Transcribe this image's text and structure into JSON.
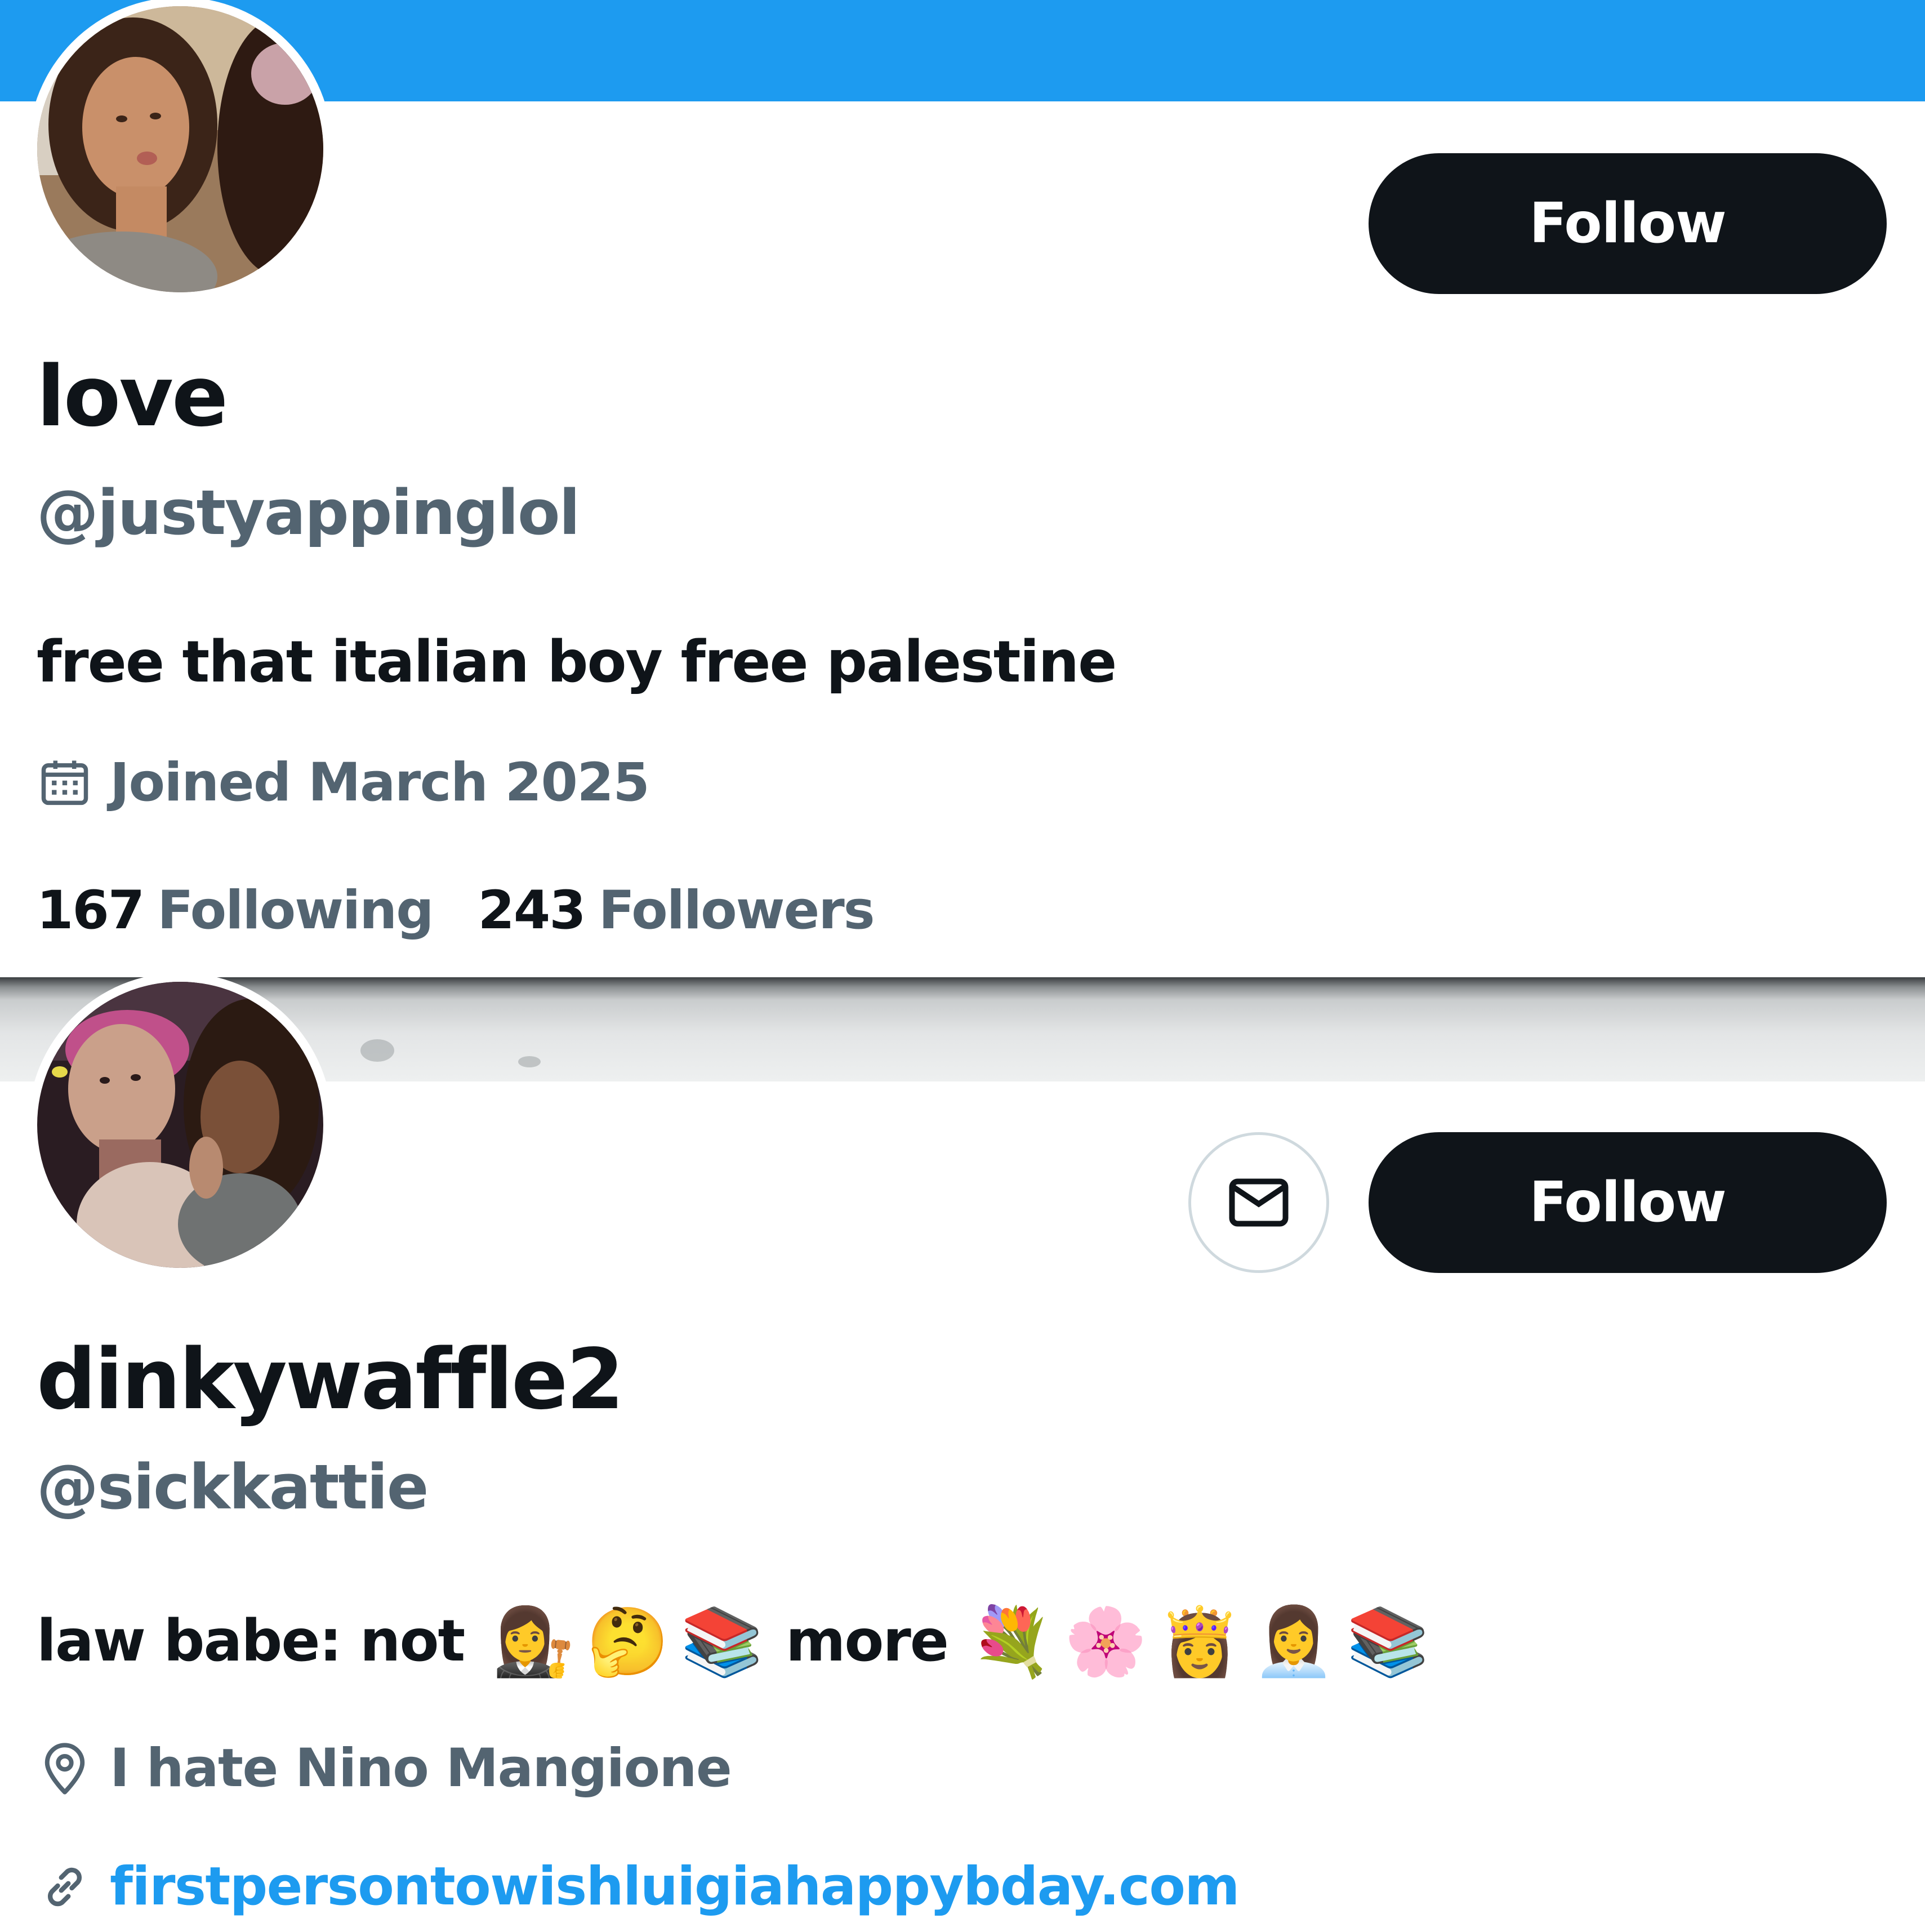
{
  "profiles": [
    {
      "display_name": "love",
      "handle": "@justyappinglol",
      "bio": "free that italian boy free palestine",
      "joined": "Joined March 2025",
      "following_count": "167",
      "following_label": "Following",
      "followers_count": "243",
      "followers_label": "Followers",
      "follow_label": "Follow",
      "banner_color": "#1d9bf0"
    },
    {
      "display_name": "dinkywaffle2",
      "handle": "@sickkattie",
      "bio_text_1": "law babe: not",
      "bio_emoji_1": [
        "👩‍⚖️",
        "🤔",
        "📚"
      ],
      "bio_text_2": "more",
      "bio_emoji_2": [
        "💐",
        "🌸",
        "👸",
        "👩‍💼",
        "📚"
      ],
      "location": "I hate Nino Mangione",
      "website": "firstpersontowishluigiahappybday.com",
      "follow_label": "Follow"
    }
  ],
  "icons": {
    "calendar": "calendar-icon",
    "location": "location-pin-icon",
    "link": "link-icon",
    "message": "envelope-icon"
  },
  "colors": {
    "primary_text": "#0f1419",
    "secondary_text": "#536471",
    "link": "#1d9bf0",
    "button_bg": "#0f1419"
  }
}
